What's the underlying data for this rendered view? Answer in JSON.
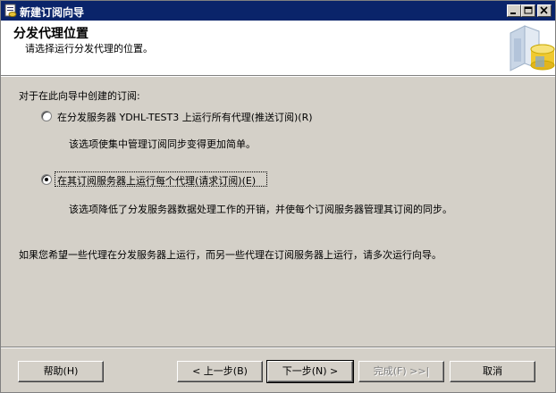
{
  "window": {
    "title": "新建订阅向导",
    "minimize_glyph": "_",
    "maximize_glyph": "□",
    "close_glyph": "×"
  },
  "header": {
    "title": "分发代理位置",
    "subtitle": "请选择运行分发代理的位置。",
    "graphic": "database-wizard-graphic"
  },
  "body": {
    "prompt": "对于在此向导中创建的订阅:",
    "options": [
      {
        "label": "在分发服务器 YDHL-TEST3 上运行所有代理(推送订阅)(R)",
        "description": "该选项使集中管理订阅同步变得更加简单。",
        "selected": false
      },
      {
        "label": "在其订阅服务器上运行每个代理(请求订阅)(E)",
        "description": "该选项降低了分发服务器数据处理工作的开销，并使每个订阅服务器管理其订阅的同步。",
        "selected": true
      }
    ],
    "note": "如果您希望一些代理在分发服务器上运行，而另一些代理在订阅服务器上运行，请多次运行向导。"
  },
  "buttons": {
    "help": "帮助(H)",
    "back": "< 上一步(B)",
    "next": "下一步(N) >",
    "finish": "完成(F) >>|",
    "cancel": "取消"
  },
  "colors": {
    "titlebar": "#0a246a",
    "dialog_bg": "#d4d0c8",
    "header_bg": "#ffffff"
  }
}
